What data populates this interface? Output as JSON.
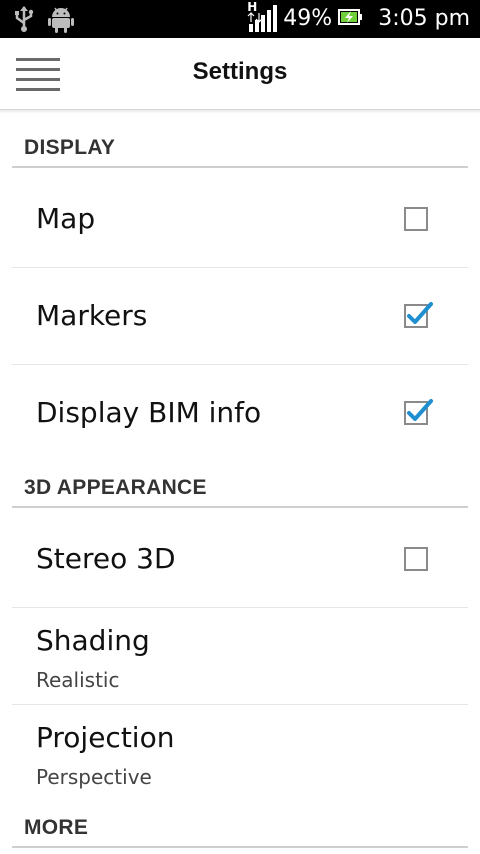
{
  "status_bar": {
    "network_type": "H",
    "battery_percent": "49%",
    "time": "3:05 pm",
    "icons": [
      "usb-icon",
      "android-icon",
      "signal-icon",
      "battery-charging-icon"
    ]
  },
  "action_bar": {
    "title": "Settings"
  },
  "sections": {
    "display": {
      "header": "DISPLAY",
      "items": [
        {
          "label": "Map",
          "checked": false
        },
        {
          "label": "Markers",
          "checked": true
        },
        {
          "label": "Display BIM info",
          "checked": true
        }
      ]
    },
    "appearance": {
      "header": "3D APPEARANCE",
      "items": [
        {
          "label": "Stereo 3D",
          "checked": false
        },
        {
          "label": "Shading",
          "value": "Realistic"
        },
        {
          "label": "Projection",
          "value": "Perspective"
        }
      ]
    },
    "more": {
      "header": "MORE"
    }
  },
  "colors": {
    "check_accent": "#1f8fd0",
    "status_bar_bg": "#000000",
    "battery_fill": "#6fcf3a"
  }
}
